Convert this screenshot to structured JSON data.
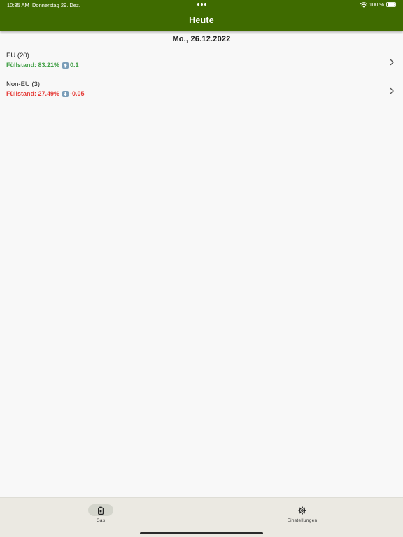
{
  "status_bar": {
    "time": "10:35 AM",
    "date": "Donnerstag 29. Dez.",
    "battery": "100 %"
  },
  "header": {
    "title": "Heute",
    "background_color": "#3f6b00"
  },
  "main": {
    "date": "Mo., 26.12.2022",
    "items": [
      {
        "title": "EU (20)",
        "status_label": "Füllstand: 83.21%",
        "trend_icon": "arrow-up-icon",
        "change": "0.1",
        "color": "#43a047"
      },
      {
        "title": "Non-EU (3)",
        "status_label": "Füllstand: 27.49%",
        "trend_icon": "arrow-down-icon",
        "change": "-0.05",
        "color": "#e53935"
      }
    ]
  },
  "tabs": [
    {
      "label": "Gas",
      "icon": "gas-canister-icon",
      "selected": true
    },
    {
      "label": "Einstellungen",
      "icon": "gear-icon",
      "selected": false
    }
  ]
}
